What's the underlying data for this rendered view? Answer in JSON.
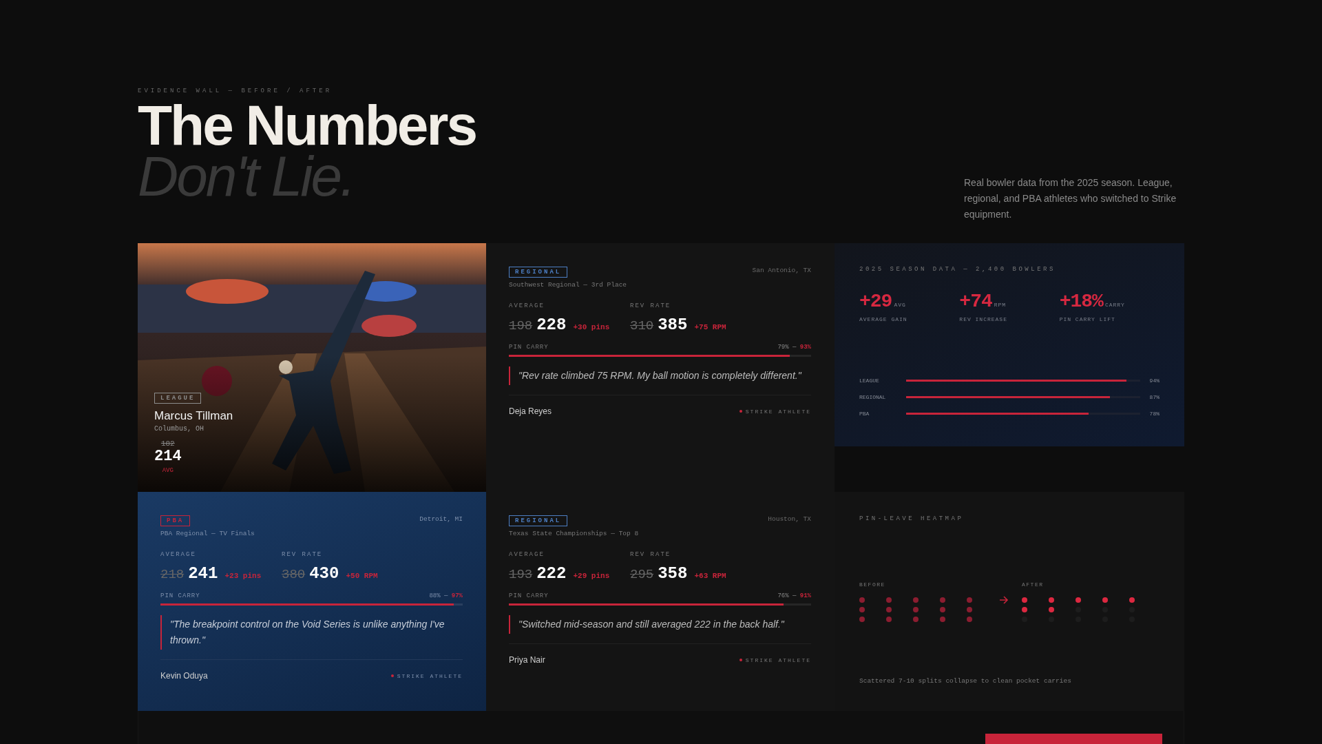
{
  "eyebrow": "EVIDENCE WALL — BEFORE / AFTER",
  "title": "The Numbers",
  "subtitle": "Don't Lie.",
  "description": "Real bowler data from the 2025 season. League, regional, and PBA athletes who switched to Strike equipment.",
  "cards": [
    {
      "tag": {
        "text": "LEAGUE",
        "color": "#8c8c8c"
      },
      "name": "Marcus Tillman",
      "location": "Columbus, OH",
      "before": "182",
      "after": "214",
      "unit": "AVG"
    },
    {
      "kind": "testimonial",
      "highlighted": false,
      "tag": {
        "text": "REGIONAL",
        "color": "#4d7fc4"
      },
      "location": "San Antonio, TX",
      "event": "Southwest Regional — 3rd Place",
      "stats": [
        {
          "label": "AVERAGE",
          "before": "198",
          "after": "228",
          "delta": "+30 pins"
        },
        {
          "label": "REV RATE",
          "before": "310",
          "after": "385",
          "delta": "+75 RPM"
        }
      ],
      "carry": {
        "label": "PIN CARRY",
        "from": "79%",
        "separator": "—",
        "to": "93%",
        "level": 0.93
      },
      "quote": "\"Rev rate climbed 75 RPM. My ball motion is completely different.\"",
      "athlete": "Deja Reyes",
      "badge": "STRIKE ATHLETE"
    },
    {
      "kind": "season",
      "title": "2025 SEASON DATA — 2,400 BOWLERS",
      "metrics": [
        {
          "value": "+29",
          "unit": "AVG",
          "label": "AVERAGE GAIN"
        },
        {
          "value": "+74",
          "unit": "RPM",
          "label": "REV INCREASE"
        },
        {
          "value": "+18%",
          "unit": "CARRY",
          "label": "PIN CARRY LIFT"
        }
      ],
      "bars": [
        {
          "label": "LEAGUE",
          "value": "94%",
          "level": 0.94
        },
        {
          "label": "REGIONAL",
          "value": "87%",
          "level": 0.87
        },
        {
          "label": "PBA",
          "value": "78%",
          "level": 0.78
        }
      ]
    },
    {
      "kind": "testimonial",
      "highlighted": true,
      "tag": {
        "text": "PBA",
        "color": "#c8243a"
      },
      "location": "Detroit, MI",
      "event": "PBA Regional — TV Finals",
      "stats": [
        {
          "label": "AVERAGE",
          "before": "218",
          "after": "241",
          "delta": "+23 pins"
        },
        {
          "label": "REV RATE",
          "before": "380",
          "after": "430",
          "delta": "+50 RPM"
        }
      ],
      "carry": {
        "label": "PIN CARRY",
        "from": "88%",
        "separator": "—",
        "to": "97%",
        "level": 0.97
      },
      "quote": "\"The breakpoint control on the Void Series is unlike anything I've thrown.\"",
      "athlete": "Kevin Oduya",
      "badge": "STRIKE ATHLETE"
    },
    {
      "kind": "testimonial",
      "highlighted": false,
      "tag": {
        "text": "REGIONAL",
        "color": "#4d7fc4"
      },
      "location": "Houston, TX",
      "event": "Texas State Championships — Top 8",
      "stats": [
        {
          "label": "AVERAGE",
          "before": "193",
          "after": "222",
          "delta": "+29 pins"
        },
        {
          "label": "REV RATE",
          "before": "295",
          "after": "358",
          "delta": "+63 RPM"
        }
      ],
      "carry": {
        "label": "PIN CARRY",
        "from": "76%",
        "separator": "—",
        "to": "91%",
        "level": 0.91
      },
      "quote": "\"Switched mid-season and still averaged 222 in the back half.\"",
      "athlete": "Priya Nair",
      "badge": "STRIKE ATHLETE"
    },
    {
      "kind": "heatmap",
      "title": "PIN-LEAVE HEATMAP",
      "before_label": "BEFORE",
      "after_label": "AFTER",
      "before": [
        [
          true,
          true,
          true,
          true,
          true
        ],
        [
          true,
          true,
          true,
          true,
          true
        ],
        [
          true,
          true,
          true,
          true,
          true
        ]
      ],
      "after": [
        [
          true,
          true,
          true,
          true,
          true
        ],
        [
          true,
          true,
          false,
          false,
          false
        ],
        [
          false,
          false,
          false,
          false,
          false
        ]
      ],
      "caption": "Scattered 7-10 splits collapse to clean pocket carries"
    }
  ]
}
